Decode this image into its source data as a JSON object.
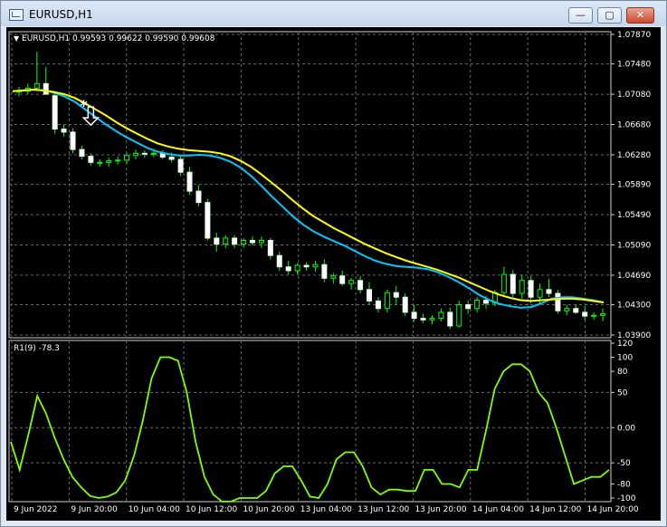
{
  "window": {
    "title": "EURUSD,H1",
    "buttons": {
      "minimize": "—",
      "maximize": "▢",
      "close": "✕"
    }
  },
  "chart_data": [
    {
      "type": "candlestick",
      "title": "EURUSD,H1 0.99593 0.99622 0.99590 0.99608",
      "symbol": "EURUSD,H1",
      "ohlc_readout": "0.99593 0.99622 0.99590 0.99608",
      "price_ticks": [
        "1.07870",
        "1.07480",
        "1.07080",
        "1.06680",
        "1.06280",
        "1.05890",
        "1.05490",
        "1.05090",
        "1.04690",
        "1.04300",
        "1.03900"
      ],
      "ylim": [
        1.039,
        1.0787
      ],
      "time_ticks": [
        "9 Jun 2022",
        "9 Jun 20:00",
        "10 Jun 04:00",
        "10 Jun 12:00",
        "10 Jun 20:00",
        "13 Jun 04:00",
        "13 Jun 12:00",
        "13 Jun 20:00",
        "14 Jun 04:00",
        "14 Jun 12:00",
        "14 Jun 20:00"
      ],
      "candle_color": "#00ff00",
      "series": [
        {
          "values": [
            1.0712,
            1.0713,
            1.0714,
            1.0713,
            1.071,
            1.0705,
            1.0698,
            1.0688,
            1.0678,
            1.0668,
            1.0659,
            1.0651,
            1.0644,
            1.0637,
            1.0632,
            1.0629,
            1.0627,
            1.0627,
            1.0628,
            1.0627,
            1.0624,
            1.0619,
            1.0611,
            1.06,
            1.0587,
            1.0573,
            1.056,
            1.0547,
            1.0536,
            1.0527,
            1.052,
            1.0514,
            1.0508,
            1.0501,
            1.0494,
            1.0488,
            1.0484,
            1.0481,
            1.048,
            1.0479,
            1.0477,
            1.0473,
            1.0467,
            1.046,
            1.0452,
            1.0443,
            1.0436,
            1.0431,
            1.0428,
            1.0426,
            1.0427,
            1.0432,
            1.0438,
            1.044,
            1.044,
            1.0438,
            1.0436,
            1.0433
          ],
          "color": "#00c8ff"
        },
        {
          "values": [
            1.0712,
            1.0713,
            1.0714,
            1.0713,
            1.0711,
            1.0708,
            1.0703,
            1.0696,
            1.0688,
            1.068,
            1.0671,
            1.0663,
            1.0656,
            1.0649,
            1.0643,
            1.0639,
            1.0636,
            1.0634,
            1.0633,
            1.0632,
            1.063,
            1.0626,
            1.062,
            1.0612,
            1.0602,
            1.0591,
            1.058,
            1.0568,
            1.0557,
            1.0547,
            1.0539,
            1.0531,
            1.0524,
            1.0517,
            1.051,
            1.0504,
            1.0498,
            1.0493,
            1.0488,
            1.0484,
            1.048,
            1.0476,
            1.0471,
            1.0466,
            1.046,
            1.0454,
            1.0448,
            1.0443,
            1.0439,
            1.0436,
            1.0435,
            1.0436,
            1.0437,
            1.0438,
            1.0438,
            1.0437,
            1.0435,
            1.0433
          ],
          "color": "#ffff00"
        }
      ],
      "candles": [
        [
          1.0712,
          1.0718,
          1.0705,
          1.0712
        ],
        [
          1.0712,
          1.0722,
          1.0708,
          1.0716
        ],
        [
          1.0716,
          1.0764,
          1.0712,
          1.0722
        ],
        [
          1.0722,
          1.0744,
          1.0715,
          1.0708
        ],
        [
          1.0706,
          1.0712,
          1.0656,
          1.0662
        ],
        [
          1.0662,
          1.0668,
          1.0652,
          1.0658
        ],
        [
          1.0658,
          1.0663,
          1.063,
          1.0635
        ],
        [
          1.0635,
          1.064,
          1.0622,
          1.0626
        ],
        [
          1.0626,
          1.063,
          1.0614,
          1.0618
        ],
        [
          1.0618,
          1.0622,
          1.0612,
          1.0618
        ],
        [
          1.0618,
          1.0624,
          1.0612,
          1.062
        ],
        [
          1.062,
          1.0626,
          1.0615,
          1.0621
        ],
        [
          1.0621,
          1.063,
          1.0616,
          1.0627
        ],
        [
          1.0627,
          1.0635,
          1.0622,
          1.063
        ],
        [
          1.063,
          1.0634,
          1.0624,
          1.0629
        ],
        [
          1.0629,
          1.0634,
          1.0625,
          1.063
        ],
        [
          1.063,
          1.0634,
          1.0622,
          1.0625
        ],
        [
          1.0625,
          1.0631,
          1.0618,
          1.0622
        ],
        [
          1.0622,
          1.0628,
          1.06,
          1.0605
        ],
        [
          1.0605,
          1.0612,
          1.0575,
          1.058
        ],
        [
          1.058,
          1.0588,
          1.056,
          1.0565
        ],
        [
          1.0565,
          1.057,
          1.0515,
          1.0518
        ],
        [
          1.0518,
          1.0525,
          1.05,
          1.051
        ],
        [
          1.051,
          1.0522,
          1.0505,
          1.0518
        ],
        [
          1.0518,
          1.0522,
          1.0505,
          1.051
        ],
        [
          1.051,
          1.0518,
          1.0505,
          1.0515
        ],
        [
          1.0515,
          1.052,
          1.0508,
          1.0512
        ],
        [
          1.0512,
          1.052,
          1.0505,
          1.0515
        ],
        [
          1.0515,
          1.0518,
          1.049,
          1.0495
        ],
        [
          1.0495,
          1.05,
          1.0475,
          1.048
        ],
        [
          1.048,
          1.0488,
          1.047,
          1.0475
        ],
        [
          1.0475,
          1.0485,
          1.047,
          1.0482
        ],
        [
          1.0482,
          1.0486,
          1.0475,
          1.048
        ],
        [
          1.048,
          1.0488,
          1.0474,
          1.0483
        ],
        [
          1.0483,
          1.049,
          1.046,
          1.0465
        ],
        [
          1.0465,
          1.0472,
          1.0458,
          1.0468
        ],
        [
          1.0468,
          1.0475,
          1.0455,
          1.0458
        ],
        [
          1.0458,
          1.0465,
          1.045,
          1.0462
        ],
        [
          1.0462,
          1.0468,
          1.0445,
          1.045
        ],
        [
          1.045,
          1.046,
          1.043,
          1.0435
        ],
        [
          1.0435,
          1.044,
          1.042,
          1.0425
        ],
        [
          1.0425,
          1.045,
          1.042,
          1.0446
        ],
        [
          1.0446,
          1.0455,
          1.043,
          1.044
        ],
        [
          1.044,
          1.0445,
          1.0415,
          1.042
        ],
        [
          1.042,
          1.043,
          1.0408,
          1.0412
        ],
        [
          1.0412,
          1.0418,
          1.0406,
          1.041
        ],
        [
          1.041,
          1.0416,
          1.0404,
          1.0412
        ],
        [
          1.0412,
          1.0425,
          1.0408,
          1.042
        ],
        [
          1.042,
          1.0426,
          1.0398,
          1.0402
        ],
        [
          1.0402,
          1.0435,
          1.04,
          1.043
        ],
        [
          1.043,
          1.0436,
          1.0418,
          1.0425
        ],
        [
          1.0425,
          1.044,
          1.042,
          1.0436
        ],
        [
          1.0436,
          1.0442,
          1.0425,
          1.0432
        ],
        [
          1.0432,
          1.045,
          1.0428,
          1.0446
        ],
        [
          1.0446,
          1.048,
          1.044,
          1.047
        ],
        [
          1.047,
          1.0476,
          1.044,
          1.0445
        ],
        [
          1.0445,
          1.047,
          1.0438,
          1.0462
        ],
        [
          1.0462,
          1.0468,
          1.0432,
          1.044
        ],
        [
          1.044,
          1.0458,
          1.043,
          1.045
        ],
        [
          1.045,
          1.0464,
          1.044,
          1.0445
        ],
        [
          1.0445,
          1.045,
          1.0418,
          1.0422
        ],
        [
          1.0422,
          1.043,
          1.0416,
          1.0425
        ],
        [
          1.0425,
          1.043,
          1.0418,
          1.042
        ],
        [
          1.042,
          1.0428,
          1.041,
          1.0415
        ],
        [
          1.0415,
          1.042,
          1.041,
          1.0416
        ],
        [
          1.0416,
          1.0425,
          1.0408,
          1.0418
        ]
      ]
    },
    {
      "type": "line",
      "title": "R1(9) -78.3",
      "y_ticks": [
        "120",
        "100",
        "80",
        "50",
        "0.00",
        "-50",
        "-80",
        "-100"
      ],
      "ylim": [
        -100,
        120
      ],
      "color": "#80ff00",
      "values": [
        -20,
        -60,
        -10,
        45,
        20,
        -15,
        -45,
        -70,
        -85,
        -97,
        -100,
        -98,
        -92,
        -75,
        -40,
        10,
        70,
        100,
        100,
        95,
        50,
        -20,
        -70,
        -95,
        -105,
        -105,
        -100,
        -100,
        -100,
        -90,
        -65,
        -55,
        -55,
        -75,
        -98,
        -100,
        -80,
        -45,
        -35,
        -35,
        -55,
        -85,
        -95,
        -88,
        -88,
        -90,
        -90,
        -60,
        -60,
        -80,
        -80,
        -85,
        -60,
        -60,
        -5,
        55,
        80,
        90,
        90,
        80,
        50,
        35,
        0,
        -40,
        -80,
        -75,
        -70,
        -70,
        -60
      ]
    }
  ]
}
